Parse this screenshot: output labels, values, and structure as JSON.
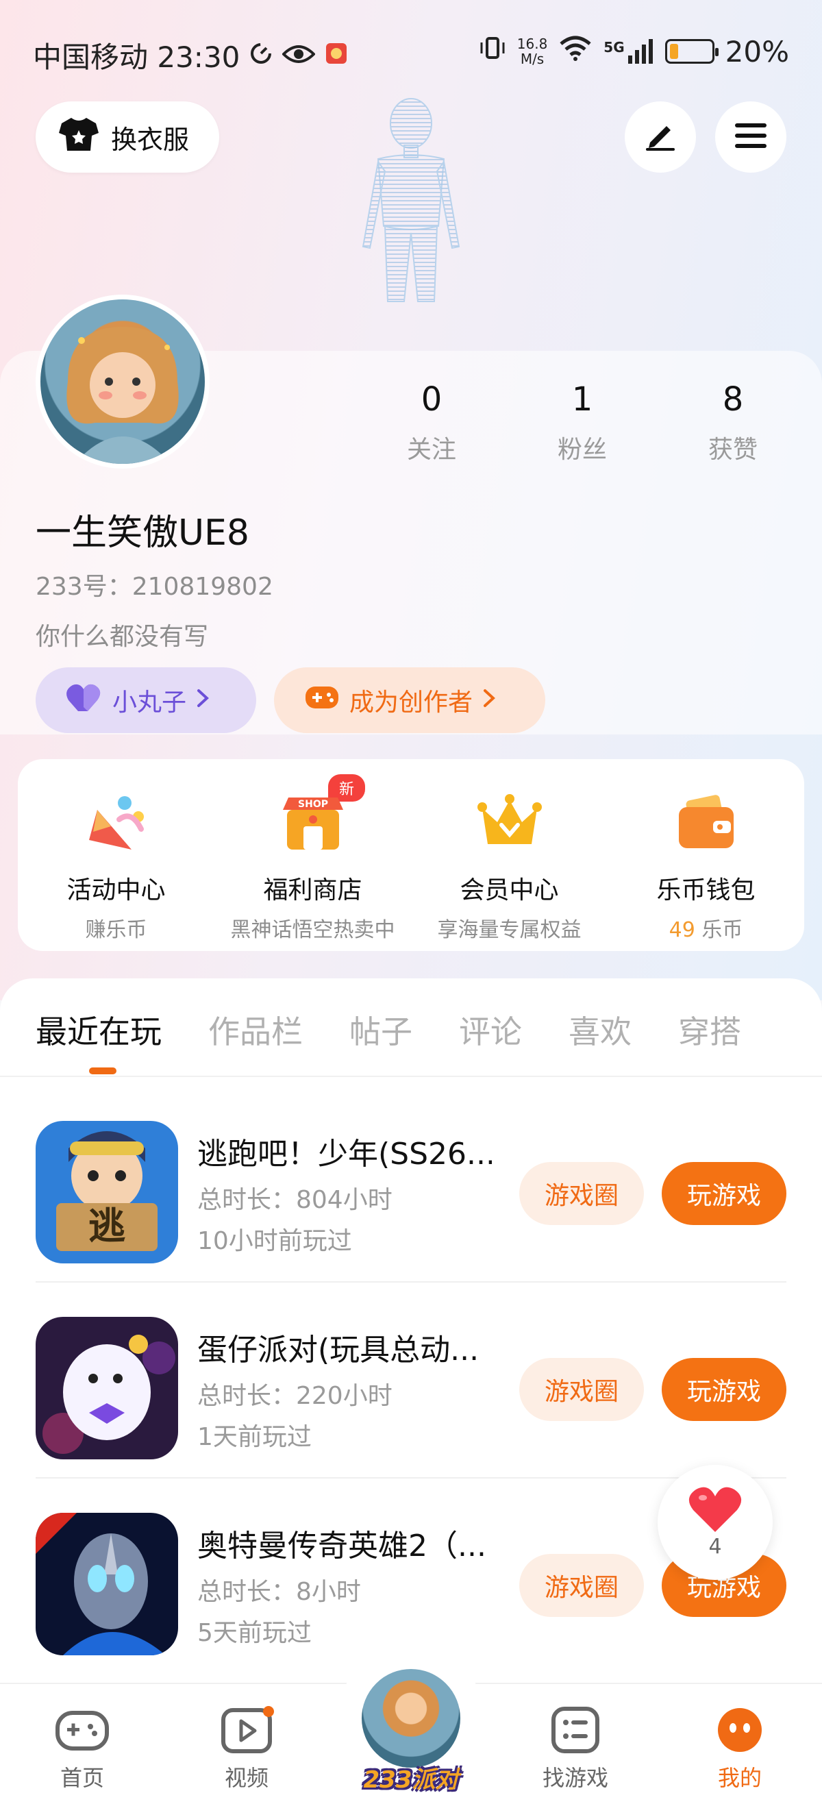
{
  "status_bar": {
    "carrier_time": "中国移动 23:30",
    "net_speed_top": "16.8",
    "net_speed_bottom": "M/s",
    "network": "5G",
    "battery": "20%",
    "battery_level": 0.2
  },
  "header": {
    "outfit_label": "换衣服"
  },
  "profile": {
    "stats": [
      {
        "value": "0",
        "label": "关注"
      },
      {
        "value": "1",
        "label": "粉丝"
      },
      {
        "value": "8",
        "label": "获赞"
      }
    ],
    "username": "一生笑傲UE8",
    "uid": "233号：210819802",
    "bio": "你什么都没有写",
    "pill_friend": "小丸子",
    "pill_creator": "成为创作者"
  },
  "services": [
    {
      "title": "活动中心",
      "sub": "赚乐币",
      "icon": "party-icon"
    },
    {
      "title": "福利商店",
      "sub": "黑神话悟空热卖中",
      "icon": "shop-icon",
      "badge": "新"
    },
    {
      "title": "会员中心",
      "sub": "享海量专属权益",
      "icon": "crown-icon"
    },
    {
      "title": "乐币钱包",
      "sub_value": "49",
      "sub_unit": " 乐币",
      "icon": "wallet-icon"
    }
  ],
  "tabs": [
    "最近在玩",
    "作品栏",
    "帖子",
    "评论",
    "喜欢",
    "穿搭"
  ],
  "games": [
    {
      "name": "逃跑吧！少年(SS26...",
      "time": "总时长：804小时",
      "last": "10小时前玩过",
      "circle": "游戏圈",
      "play": "玩游戏"
    },
    {
      "name": "蛋仔派对(玩具总动...",
      "time": "总时长：220小时",
      "last": "1天前玩过",
      "circle": "游戏圈",
      "play": "玩游戏"
    },
    {
      "name": "奥特曼传奇英雄2（...",
      "time": "总时长：8小时",
      "last": "5天前玩过",
      "circle": "游戏圈",
      "play": "玩游戏"
    }
  ],
  "like_float": {
    "count": "4"
  },
  "bottom_nav": {
    "home": "首页",
    "video": "视频",
    "center": "233派对",
    "find": "找游戏",
    "me": "我的"
  },
  "colors": {
    "accent": "#f06a14",
    "purple": "#6b4fd8",
    "coin": "#f39b2f"
  }
}
